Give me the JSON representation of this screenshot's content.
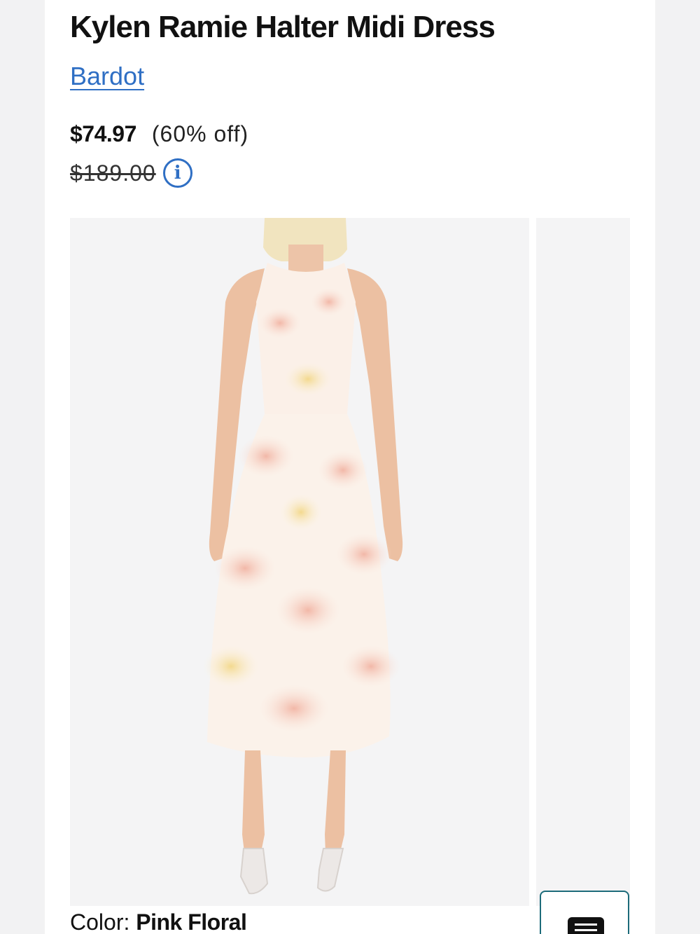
{
  "product": {
    "title": "Kylen Ramie Halter Midi Dress",
    "brand": "Bardot",
    "price_current": "$74.97",
    "discount": "(60% off)",
    "price_original": "$189.00",
    "color_label": "Color:",
    "color_value": "Pink Floral"
  },
  "colors": {
    "link": "#2f6fc4",
    "background": "#f2f2f3",
    "gallery_bg": "#f4f4f5",
    "button_border": "#1d6b7a"
  },
  "icons": {
    "info": "info-circle-icon",
    "size_chart": "size-chart-icon"
  }
}
